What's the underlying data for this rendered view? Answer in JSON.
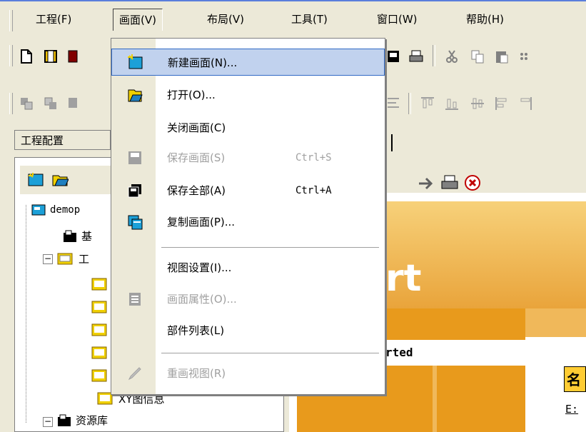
{
  "menubar": {
    "items": [
      {
        "label": "工程(F)"
      },
      {
        "label": "画面(V)"
      },
      {
        "label": "布局(V)"
      },
      {
        "label": "工具(T)"
      },
      {
        "label": "窗口(W)"
      },
      {
        "label": "帮助(H)"
      }
    ],
    "active_index": 1
  },
  "left_panel": {
    "tab_label": "工程配置",
    "tree": [
      {
        "label": "demop",
        "icon": "project-icon"
      },
      {
        "label": "基",
        "icon": "folder-icon"
      },
      {
        "label": "工",
        "icon": "folder-icon"
      },
      {
        "label": "XY图信息",
        "icon": "screen-icon"
      },
      {
        "label": "资源库",
        "icon": "folder-icon"
      }
    ]
  },
  "content": {
    "title_fragment": "rt",
    "started_fragment": "rted",
    "name_label": "名",
    "e_fragment": "E:"
  },
  "dropdown": {
    "items": [
      {
        "label": "新建画面(N)...",
        "shortcut": "",
        "disabled": false,
        "icon": "new-screen-icon",
        "highlighted": true
      },
      {
        "label": "打开(O)...",
        "shortcut": "",
        "disabled": false,
        "icon": "open-icon"
      },
      {
        "label": "关闭画面(C)",
        "shortcut": "",
        "disabled": false,
        "icon": ""
      },
      {
        "label": "保存画面(S)",
        "shortcut": "Ctrl+S",
        "disabled": true,
        "icon": "save-icon"
      },
      {
        "label": "保存全部(A)",
        "shortcut": "Ctrl+A",
        "disabled": false,
        "icon": "save-all-icon"
      },
      {
        "label": "复制画面(P)...",
        "shortcut": "",
        "disabled": false,
        "icon": "copy-screen-icon"
      },
      {
        "label": "视图设置(I)...",
        "shortcut": "",
        "disabled": false,
        "icon": ""
      },
      {
        "label": "画面属性(O)...",
        "shortcut": "",
        "disabled": true,
        "icon": "properties-icon"
      },
      {
        "label": "部件列表(L)",
        "shortcut": "",
        "disabled": false,
        "icon": ""
      },
      {
        "label": "重画视图(R)",
        "shortcut": "",
        "disabled": true,
        "icon": "redraw-icon"
      }
    ]
  },
  "colors": {
    "highlight": "#c1d2ee",
    "highlight_border": "#316ac5",
    "accent_orange": "#e89a1c"
  }
}
